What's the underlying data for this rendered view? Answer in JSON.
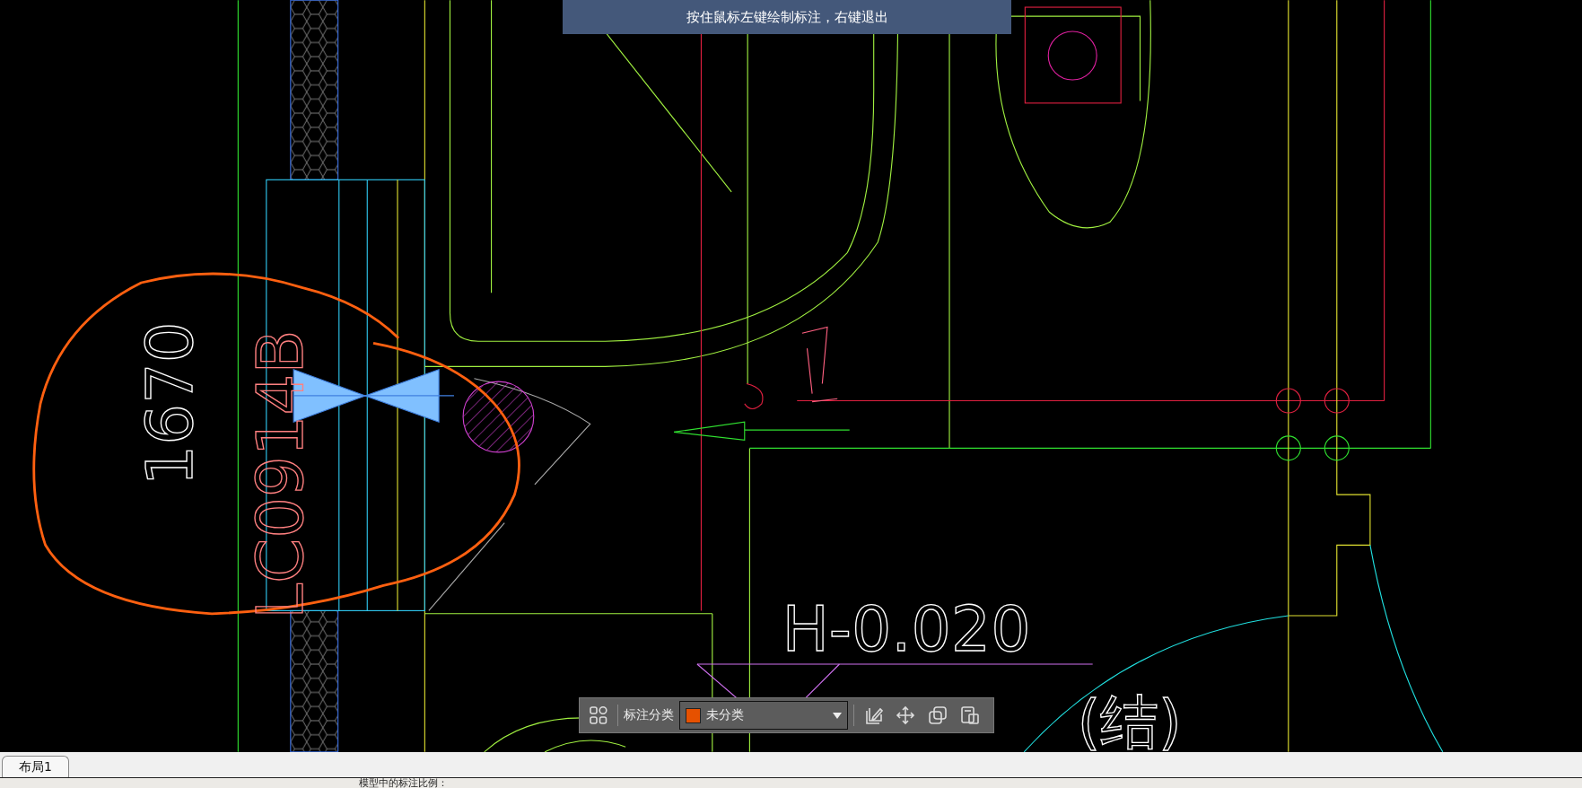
{
  "hint_banner": "按住鼠标左键绘制标注，右键退出",
  "drawing_labels": [
    {
      "text": "1670",
      "kind": "vertical"
    },
    {
      "text": "LC0914B",
      "kind": "vertical"
    },
    {
      "text": "H-0.020",
      "kind": "horizontal"
    },
    {
      "text": "(结)",
      "kind": "horizontal"
    }
  ],
  "annotation_toolbar": {
    "label": "标注分类",
    "category": {
      "value": "未分类",
      "color": "#e65100"
    }
  },
  "layout_tabs": [
    {
      "label": "布局1",
      "selected": true
    }
  ],
  "status_bar": {
    "text": "模型中的标注比例："
  }
}
